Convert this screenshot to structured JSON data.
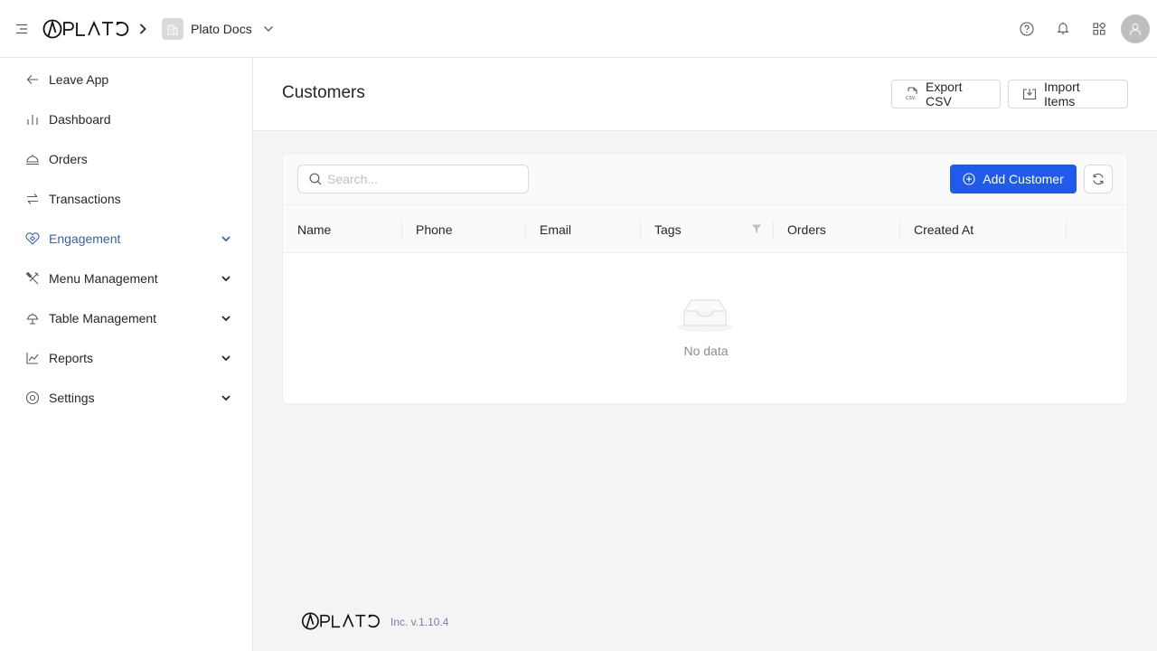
{
  "header": {
    "workspace_name": "Plato Docs"
  },
  "sidebar": {
    "items": [
      {
        "label": "Leave App"
      },
      {
        "label": "Dashboard"
      },
      {
        "label": "Orders"
      },
      {
        "label": "Transactions"
      },
      {
        "label": "Engagement"
      },
      {
        "label": "Menu Management"
      },
      {
        "label": "Table Management"
      },
      {
        "label": "Reports"
      },
      {
        "label": "Settings"
      }
    ],
    "active": "Engagement",
    "accent_color": "#3a62a8"
  },
  "page": {
    "title": "Customers",
    "export_label": "Export CSV",
    "import_label": "Import Items"
  },
  "toolbar": {
    "search_placeholder": "Search...",
    "add_label": "Add Customer",
    "primary_color": "#1f5ae8"
  },
  "table": {
    "columns": [
      "Name",
      "Phone",
      "Email",
      "Tags",
      "Orders",
      "Created At"
    ],
    "empty_text": "No data"
  },
  "footer": {
    "version": "Inc. v.1.10.4"
  }
}
